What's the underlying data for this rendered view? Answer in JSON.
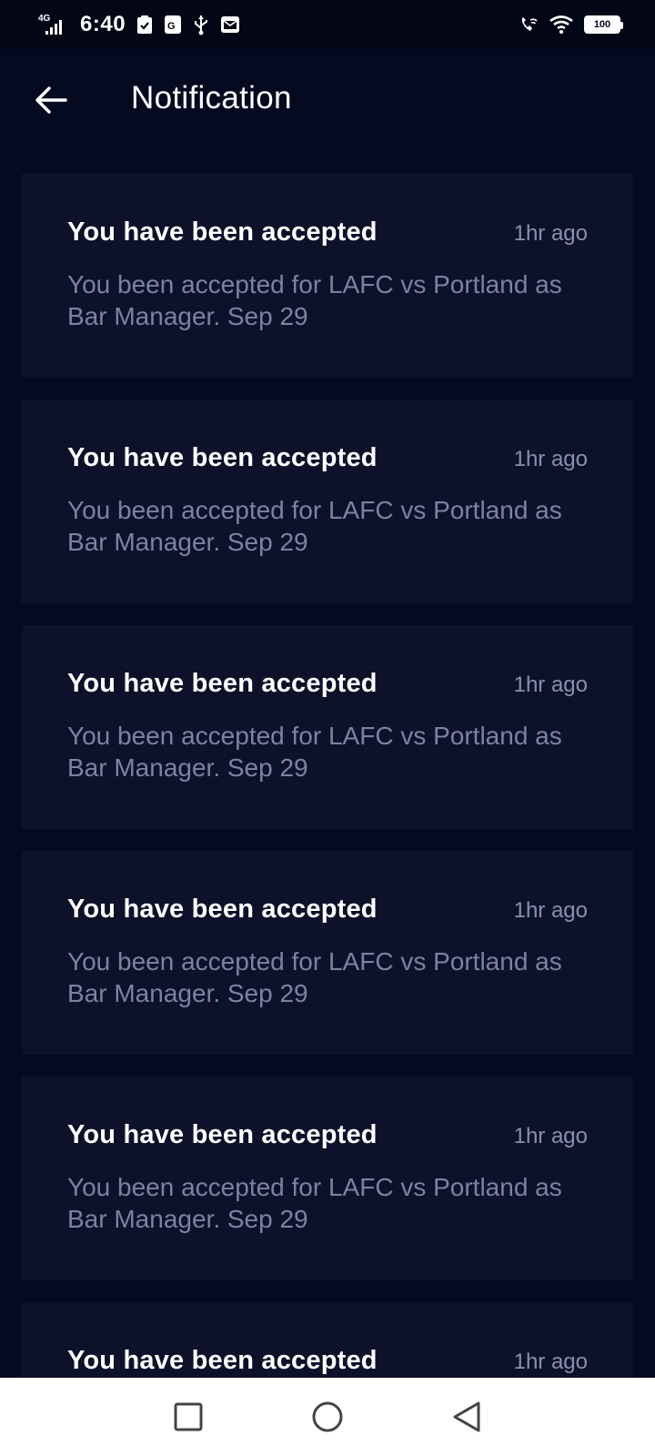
{
  "status_bar": {
    "network": "4G",
    "time": "6:40",
    "battery": "100",
    "icons": [
      "signal-icon",
      "shield-check-icon",
      "sim-icon",
      "usb-icon",
      "mail-icon",
      "wifi-calling-icon",
      "wifi-icon",
      "battery-icon"
    ]
  },
  "header": {
    "back_icon": "arrow-left-icon",
    "title": "Notification"
  },
  "notifications": [
    {
      "title": "You have been accepted",
      "time": "1hr ago",
      "body": "You been accepted for LAFC vs Portland as Bar Manager. Sep 29"
    },
    {
      "title": "You have been accepted",
      "time": "1hr ago",
      "body": "You been accepted for LAFC vs Portland as Bar Manager. Sep 29"
    },
    {
      "title": "You have been accepted",
      "time": "1hr ago",
      "body": "You been accepted for LAFC vs Portland as Bar Manager. Sep 29"
    },
    {
      "title": "You have been accepted",
      "time": "1hr ago",
      "body": "You been accepted for LAFC vs Portland as Bar Manager. Sep 29"
    },
    {
      "title": "You have been accepted",
      "time": "1hr ago",
      "body": "You been accepted for LAFC vs Portland as Bar Manager. Sep 29"
    },
    {
      "title": "You have been accepted",
      "time": "1hr ago",
      "body": ""
    }
  ],
  "nav_bar": {
    "icons": [
      "recent-apps-icon",
      "home-icon",
      "back-icon"
    ]
  },
  "colors": {
    "background": "#060a20",
    "card": "#0d1129",
    "status_bar": "#030615",
    "muted_text": "#7d82a3",
    "nav_bar": "#ffffff"
  }
}
